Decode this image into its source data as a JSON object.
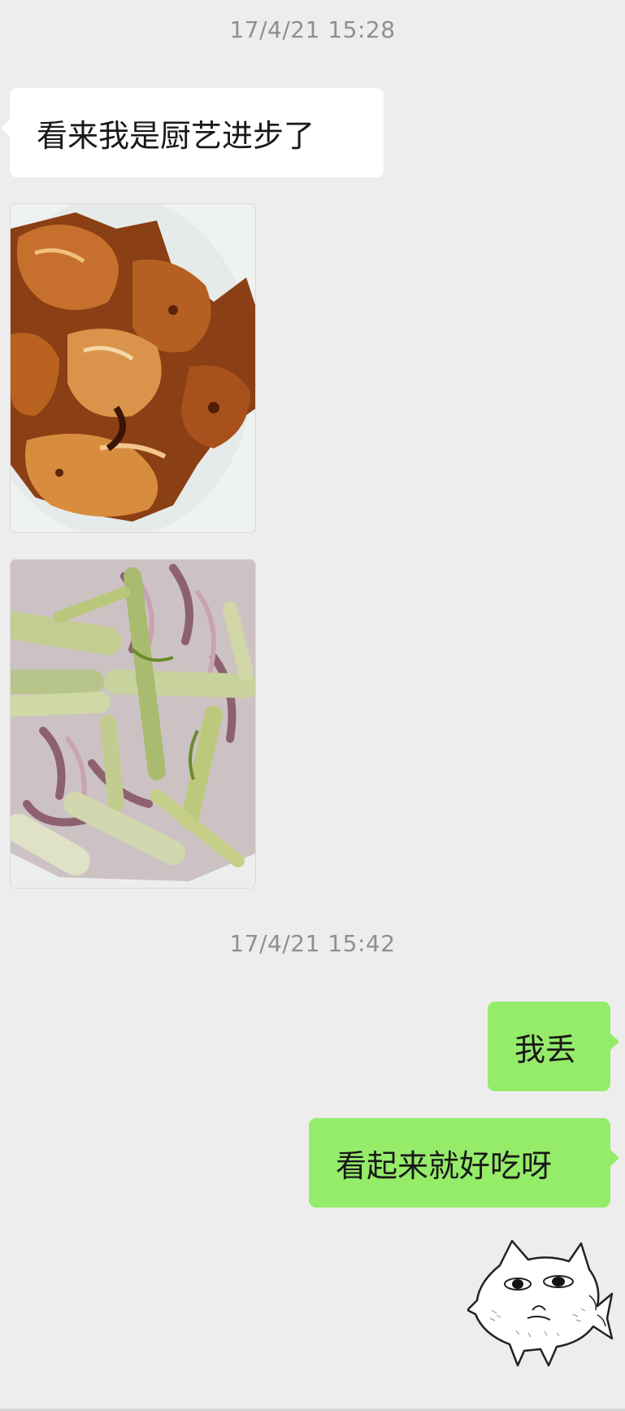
{
  "chat": {
    "time_1": "17/4/21 15:28",
    "time_2": "17/4/21 15:42",
    "messages": [
      {
        "side": "left",
        "type": "text",
        "text": "看来我是厨艺进步了"
      },
      {
        "side": "left",
        "type": "image",
        "image": "braised-chicken-wings-photo"
      },
      {
        "side": "left",
        "type": "image",
        "image": "squid-celery-stir-fry-photo"
      },
      {
        "side": "right",
        "type": "text",
        "text": "我丢"
      },
      {
        "side": "right",
        "type": "text",
        "text": "看起来就好吃呀"
      },
      {
        "side": "right",
        "type": "sticker",
        "image": "cat-fish-meme-sticker"
      }
    ]
  },
  "colors": {
    "background": "#ededed",
    "incoming_bubble": "#ffffff",
    "outgoing_bubble": "#95ec69",
    "timestamp": "#8f8f8f"
  }
}
